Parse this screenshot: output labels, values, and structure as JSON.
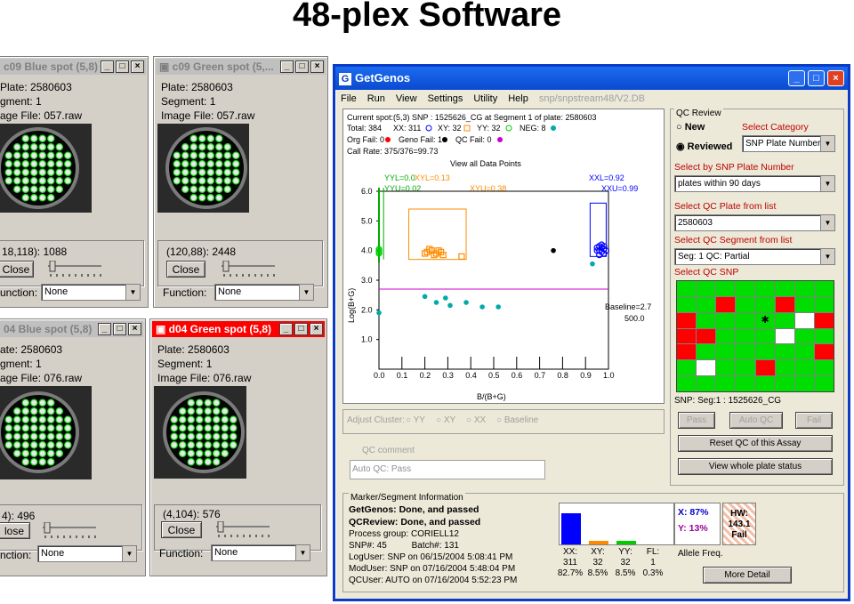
{
  "slide": {
    "title": "48-plex Software"
  },
  "spot_windows": [
    {
      "title": "c09 Blue spot (5,8)",
      "plate": "Plate: 2580603",
      "segment": "gment: 1",
      "image_file": "age File: 057.raw",
      "coord": "18,118): 1088",
      "close": "Close",
      "function_label": "unction:",
      "function_value": "None"
    },
    {
      "title": "c09 Green spot (5,...",
      "plate": "Plate: 2580603",
      "segment": "Segment: 1",
      "image_file": "Image File: 057.raw",
      "coord": "(120,88): 2448",
      "close": "Close",
      "function_label": "Function:",
      "function_value": "None"
    },
    {
      "title": "04 Blue spot (5,8)",
      "plate": "ate: 2580603",
      "segment": "gment: 1",
      "image_file": "age File: 076.raw",
      "coord": "4): 496",
      "close": "lose",
      "function_label": "nction:",
      "function_value": "None"
    },
    {
      "title": "d04 Green spot (5,8)",
      "plate": "Plate: 2580603",
      "segment": "Segment: 1",
      "image_file": "Image File: 076.raw",
      "coord": "(4,104): 576",
      "close": "Close",
      "function_label": "Function:",
      "function_value": "None"
    }
  ],
  "getgenos": {
    "title": "GetGenos",
    "menu": [
      "File",
      "Run",
      "View",
      "Settings",
      "Utility",
      "Help"
    ],
    "db_path": "snp/snpstream48/V2.DB",
    "plot_header": {
      "line1": "Current spot:(5,3)   SNP : 1525626_CG   at Segment 1 of plate: 2580603",
      "total": "Total:  384",
      "xx": "XX: 311",
      "xy": "XY: 32",
      "yy": "YY: 32",
      "neg": "NEG: 8",
      "org_fail": "Org Fail: 0",
      "geno_fail": "Geno Fail: 1",
      "qc_fail": "QC Fail: 0",
      "call_rate": "Call Rate: 375/376=99.73",
      "view_title": "View all Data Points"
    },
    "plot_labels": {
      "yyl": "YYL=0.0",
      "xyl": "XYL=0.13",
      "yyu": "YYU=0.02",
      "xyu": "XYU=0.38",
      "xxl": "XXL=0.92",
      "xxu": "XXU=0.99",
      "baseline": "Baseline=2.7",
      "baseline_val": "500.0",
      "ylabel": "Log(B+G)",
      "xlabel": "B/(B+G)"
    },
    "chart_data": {
      "type": "scatter",
      "xlabel": "B/(B+G)",
      "ylabel": "Log(B+G)",
      "xlim": [
        0.0,
        1.0
      ],
      "ylim": [
        0.0,
        6.0
      ],
      "x_ticks": [
        "0.0",
        "0.1",
        "0.2",
        "0.3",
        "0.4",
        "0.5",
        "0.6",
        "0.7",
        "0.8",
        "0.9",
        "1.0"
      ],
      "y_ticks": [
        "1.0",
        "2.0",
        "3.0",
        "4.0",
        "5.0",
        "6.0"
      ],
      "baseline": 2.7,
      "series": [
        {
          "name": "XX",
          "color": "#0000ff",
          "points": [
            [
              0.96,
              4.0
            ],
            [
              0.97,
              4.1
            ],
            [
              0.97,
              3.95
            ],
            [
              0.98,
              4.05
            ],
            [
              0.96,
              4.15
            ],
            [
              0.99,
              4.0
            ],
            [
              0.95,
              4.0
            ],
            [
              0.98,
              3.9
            ],
            [
              0.97,
              4.2
            ],
            [
              0.96,
              3.85
            ],
            [
              0.98,
              4.15
            ],
            [
              0.95,
              4.1
            ]
          ]
        },
        {
          "name": "XY",
          "color": "#ff8c00",
          "points": [
            [
              0.21,
              3.95
            ],
            [
              0.23,
              4.0
            ],
            [
              0.25,
              3.9
            ],
            [
              0.22,
              4.05
            ],
            [
              0.27,
              3.95
            ],
            [
              0.24,
              3.85
            ],
            [
              0.26,
              4.0
            ],
            [
              0.2,
              3.9
            ],
            [
              0.28,
              3.85
            ],
            [
              0.36,
              3.8
            ]
          ]
        },
        {
          "name": "YY",
          "color": "#00cc00",
          "points": [
            [
              0.0,
              4.0
            ],
            [
              0.0,
              3.9
            ],
            [
              0.0,
              4.05
            ],
            [
              0.0,
              3.95
            ]
          ]
        },
        {
          "name": "NEG",
          "color": "#00aaaa",
          "points": [
            [
              0.2,
              2.45
            ],
            [
              0.25,
              2.25
            ],
            [
              0.29,
              2.4
            ],
            [
              0.31,
              2.15
            ],
            [
              0.38,
              2.25
            ],
            [
              0.45,
              2.1
            ],
            [
              0.52,
              2.1
            ],
            [
              0.0,
              1.9
            ],
            [
              0.93,
              3.55
            ]
          ]
        },
        {
          "name": "Geno Fail",
          "color": "#000000",
          "points": [
            [
              0.76,
              4.0
            ]
          ]
        }
      ]
    },
    "adjust_cluster": "Adjust Cluster:",
    "adjust_options": [
      "YY",
      "XY",
      "XX",
      "Baseline"
    ],
    "qc_comment_label": "QC comment",
    "qc_comment_value": "Auto QC: Pass",
    "qc_review": {
      "title": "QC Review",
      "new": "New",
      "reviewed": "Reviewed",
      "select_category": "Select Category",
      "category_value": "SNP Plate Number",
      "select_by_snp": "Select by SNP Plate Number",
      "snp_plate_value": "plates within 90 days",
      "select_qc_plate": "Select QC Plate from list",
      "plate_value": "2580603",
      "select_segment": "Select QC Segment from list",
      "segment_value": "Seg: 1 QC: Partial",
      "select_snp": "Select QC SNP",
      "snp_info": "SNP: Seg:1 : 1525626_CG",
      "pass": "Pass",
      "auto_qc": "Auto QC",
      "fail": "Fail",
      "reset": "Reset QC of this Assay",
      "view_plate": "View whole plate status",
      "grid": [
        [
          "g",
          "g",
          "g",
          "g",
          "g",
          "g",
          "g",
          "g"
        ],
        [
          "g",
          "g",
          "r",
          "g",
          "g",
          "r",
          "g",
          "g"
        ],
        [
          "r",
          "g",
          "g",
          "g",
          "s",
          "g",
          "w",
          "r"
        ],
        [
          "r",
          "r",
          "g",
          "g",
          "g",
          "w",
          "g",
          "g"
        ],
        [
          "r",
          "g",
          "g",
          "g",
          "g",
          "g",
          "g",
          "r"
        ],
        [
          "g",
          "w",
          "g",
          "g",
          "r",
          "g",
          "g",
          "g"
        ],
        [
          "g",
          "g",
          "g",
          "g",
          "g",
          "g",
          "g",
          "g"
        ]
      ]
    },
    "marker_info": {
      "title": "Marker/Segment Information",
      "getgenos": "GetGenos: Done, and passed",
      "qcreview": "QCReview: Done, and passed",
      "process_group": "Process group: CORIELL12",
      "snp_batch": "SNP#: 45          Batch#: 131",
      "loguser": "LogUser: SNP on 06/15/2004 5:08:41 PM",
      "moduser": "ModUser: SNP on 07/16/2004 5:48:04 PM",
      "qcuser": "QCUser: AUTO on 07/16/2004 5:52:23 PM",
      "freq_x": "X: 87%",
      "freq_y": "Y: 13%",
      "hw": [
        "HW:",
        "143.1",
        "Fail"
      ],
      "bars": [
        {
          "label": "XX:",
          "count": "311",
          "pct": "82.7%",
          "value": 82.7,
          "color": "#0000ff"
        },
        {
          "label": "XY:",
          "count": "32",
          "pct": "8.5%",
          "value": 8.5,
          "color": "#ff8c00"
        },
        {
          "label": "YY:",
          "count": "32",
          "pct": "8.5%",
          "value": 8.5,
          "color": "#00cc00"
        },
        {
          "label": "FL:",
          "count": "1",
          "pct": "0.3%",
          "value": 0.3,
          "color": "#ffffff"
        }
      ],
      "allele_freq": "Allele Freq.",
      "more_detail": "More Detail"
    }
  }
}
